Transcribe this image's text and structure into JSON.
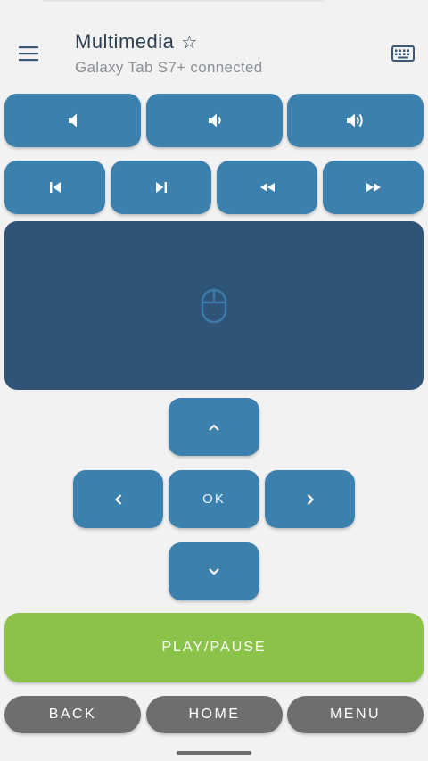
{
  "header": {
    "title": "Multimedia",
    "star": "☆",
    "subtitle": "Galaxy Tab S7+ connected"
  },
  "icons": {
    "menu": "hamburger-menu-icon",
    "keyboard": "keyboard-icon",
    "volume_mute": "volume-mute-icon",
    "volume_down": "volume-down-icon",
    "volume_up": "volume-up-icon",
    "previous": "skip-previous-icon",
    "next": "skip-next-icon",
    "rewind": "rewind-icon",
    "fast_forward": "fast-forward-icon",
    "mouse": "mouse-icon",
    "up": "chevron-up-icon",
    "left": "chevron-left-icon",
    "right": "chevron-right-icon",
    "down": "chevron-down-icon"
  },
  "dpad": {
    "ok_label": "OK"
  },
  "actions": {
    "play_pause": "PLAY/PAUSE",
    "back": "BACK",
    "home": "HOME",
    "menu": "MENU"
  },
  "colors": {
    "background": "#f2f2f2",
    "button_blue": "#3c81ae",
    "touchpad": "#2e5478",
    "play_green": "#8bc34a",
    "nav_gray": "#6e6e6e",
    "title": "#2c3e50"
  }
}
